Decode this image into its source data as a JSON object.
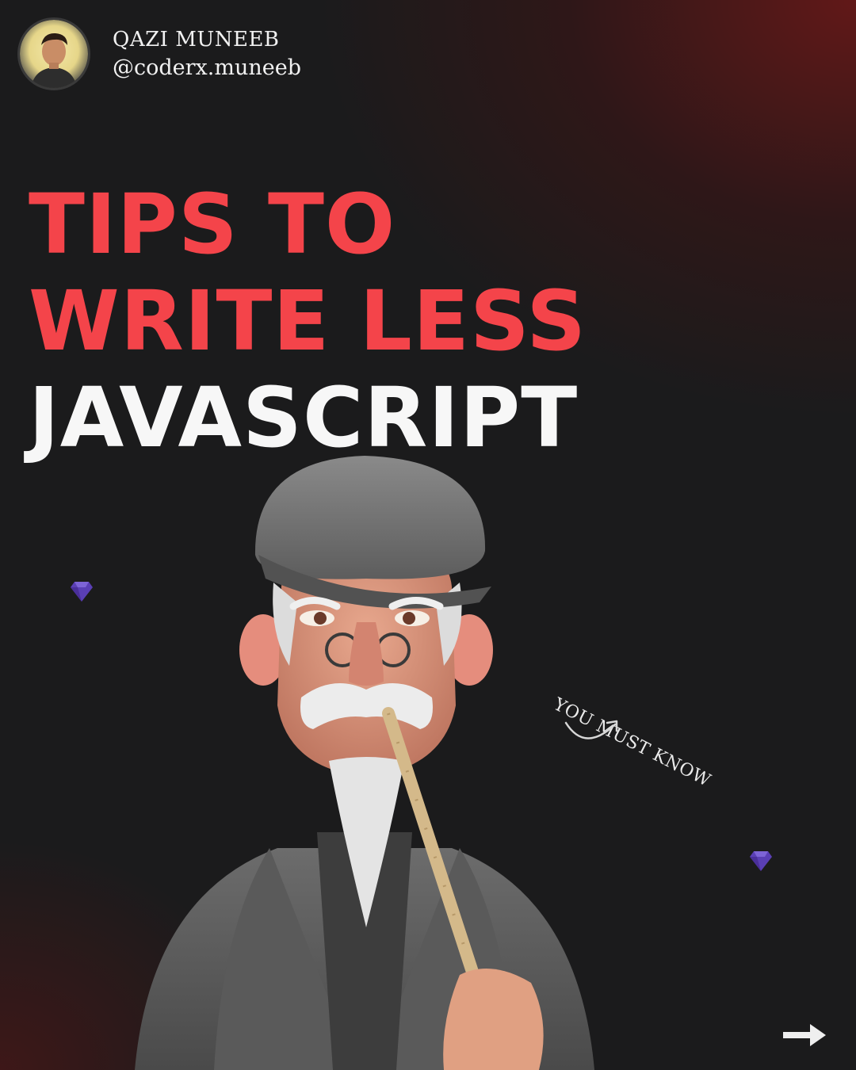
{
  "profile": {
    "name": "QAZI MUNEEB",
    "handle": "@coderx.muneeb",
    "avatar_icon": "avatar-photo"
  },
  "headline": {
    "line1": "TIPS TO",
    "line2": "WRITE LESS",
    "line3": "JAVASCRIPT"
  },
  "annotation": {
    "text": "YOU MUST KNOW"
  },
  "icons": {
    "gem": "gem-icon",
    "next": "arrow-right-icon",
    "curve": "curved-arrow-icon"
  },
  "colors": {
    "accent_red": "#f4444a",
    "text_white": "#f7f7f7",
    "background": "#1b1b1c",
    "gem_purple": "#5a3fb5"
  }
}
